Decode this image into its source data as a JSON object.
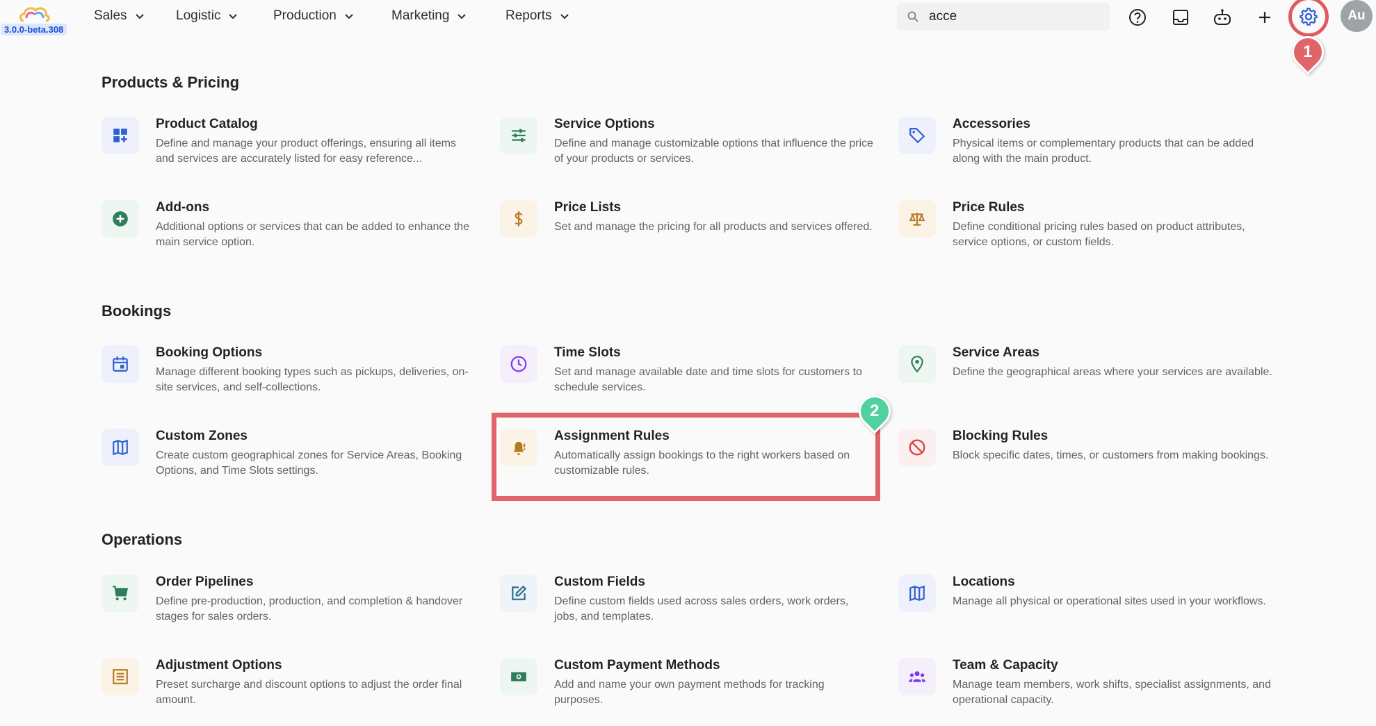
{
  "app": {
    "version": "3.0.0-beta.308"
  },
  "nav": [
    {
      "label": "Sales"
    },
    {
      "label": "Logistic"
    },
    {
      "label": "Production"
    },
    {
      "label": "Marketing"
    },
    {
      "label": "Reports"
    }
  ],
  "search": {
    "value": "acce"
  },
  "user": {
    "initials": "Au"
  },
  "markers": {
    "one": "1",
    "two": "2"
  },
  "sections": {
    "products": {
      "title": "Products & Pricing",
      "cards": [
        {
          "title": "Product Catalog",
          "desc": "Define and manage your product offerings, ensuring all items and services are accurately listed for easy reference..."
        },
        {
          "title": "Service Options",
          "desc": "Define and manage customizable options that influence the price of your products or services."
        },
        {
          "title": "Accessories",
          "desc": "Physical items or complementary products that can be added along with the main product."
        },
        {
          "title": "Add-ons",
          "desc": "Additional options or services that can be added to enhance the main service option."
        },
        {
          "title": "Price Lists",
          "desc": "Set and manage the pricing for all products and services offered."
        },
        {
          "title": "Price Rules",
          "desc": "Define conditional pricing rules based on product attributes, service options, or custom fields."
        }
      ]
    },
    "bookings": {
      "title": "Bookings",
      "cards": [
        {
          "title": "Booking Options",
          "desc": "Manage different booking types such as pickups, deliveries, on-site services, and self-collections."
        },
        {
          "title": "Time Slots",
          "desc": "Set and manage available date and time slots for customers to schedule services."
        },
        {
          "title": "Service Areas",
          "desc": "Define the geographical areas where your services are available."
        },
        {
          "title": "Custom Zones",
          "desc": "Create custom geographical zones for Service Areas, Booking Options, and Time Slots settings."
        },
        {
          "title": "Assignment Rules",
          "desc": "Automatically assign bookings to the right workers based on customizable rules."
        },
        {
          "title": "Blocking Rules",
          "desc": "Block specific dates, times, or customers from making bookings."
        }
      ]
    },
    "operations": {
      "title": "Operations",
      "cards": [
        {
          "title": "Order Pipelines",
          "desc": "Define pre-production, production, and completion & handover stages for sales orders."
        },
        {
          "title": "Custom Fields",
          "desc": "Define custom fields used across sales orders, work orders, jobs, and templates."
        },
        {
          "title": "Locations",
          "desc": "Manage all physical or operational sites used in your workflows."
        },
        {
          "title": "Adjustment Options",
          "desc": "Preset surcharge and discount options to adjust the order final amount."
        },
        {
          "title": "Custom Payment Methods",
          "desc": "Add and name your own payment methods for tracking purposes."
        },
        {
          "title": "Team & Capacity",
          "desc": "Manage team members, work shifts, specialist assignments, and operational capacity."
        }
      ]
    }
  },
  "colors": {
    "highlight": "#e0646a",
    "marker_one": "#e0646a",
    "marker_two": "#4fd1a0",
    "icon_blue": "#2f5fd0",
    "icon_green": "#2e7d5b",
    "icon_amber": "#b7791f",
    "icon_purple": "#7c3aed",
    "icon_red": "#d64545"
  }
}
